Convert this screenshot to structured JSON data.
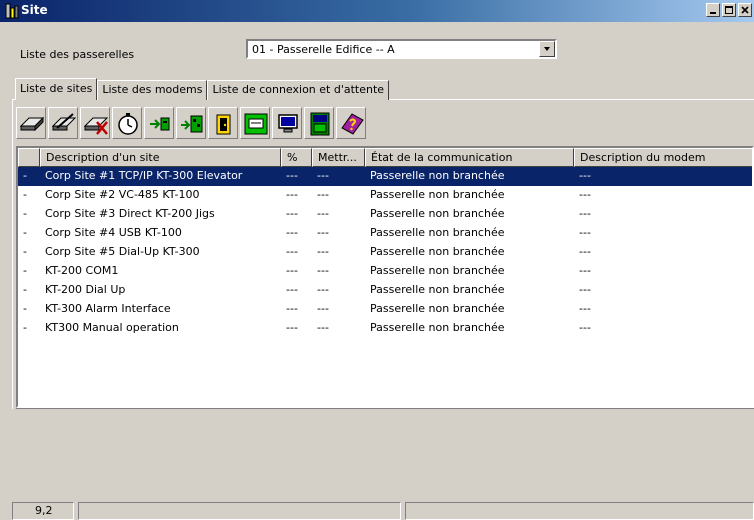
{
  "window": {
    "title": "Site",
    "icon": "site-app-icon"
  },
  "gateway": {
    "label": "Liste des passerelles",
    "selected": "01 - Passerelle Edifice -- A"
  },
  "tabs": [
    {
      "label": "Liste de sites",
      "active": true
    },
    {
      "label": "Liste des modems",
      "active": false
    },
    {
      "label": "Liste de connexion et d'attente",
      "active": false
    }
  ],
  "toolbar": [
    "add-site-icon",
    "edit-site-icon",
    "delete-site-icon",
    "schedule-clock-icon",
    "send-arrow-icon",
    "transfer-icon",
    "exit-door-icon",
    "network-icon",
    "monitor-icon",
    "serial-number-icon",
    "help-book-icon"
  ],
  "table": {
    "headers": [
      "",
      "Description d'un site",
      "%",
      "Mettr...",
      "État de la communication",
      "Description du modem"
    ],
    "rows": [
      [
        "-",
        "Corp Site #1 TCP/IP KT-300 Elevator",
        "---",
        "---",
        "Passerelle non branchée",
        "---"
      ],
      [
        "-",
        "Corp Site #2 VC-485 KT-100",
        "---",
        "---",
        "Passerelle non branchée",
        "---"
      ],
      [
        "-",
        "Corp Site #3  Direct KT-200 Jigs",
        "---",
        "---",
        "Passerelle non branchée",
        "---"
      ],
      [
        "-",
        "Corp Site #4 USB KT-100",
        "---",
        "---",
        "Passerelle non branchée",
        "---"
      ],
      [
        "-",
        "Corp Site #5 Dial-Up KT-300",
        "---",
        "---",
        "Passerelle non branchée",
        "---"
      ],
      [
        "-",
        "KT-200  COM1",
        "---",
        "---",
        "Passerelle non branchée",
        "---"
      ],
      [
        "-",
        "KT-200 Dial Up",
        "---",
        "---",
        "Passerelle non branchée",
        "---"
      ],
      [
        "-",
        "KT-300 Alarm Interface",
        "---",
        "---",
        "Passerelle non branchée",
        "---"
      ],
      [
        "-",
        "KT300 Manual operation",
        "---",
        "---",
        "Passerelle non branchée",
        "---"
      ]
    ],
    "selected_row": 0
  },
  "status": {
    "version": "9,2"
  },
  "colors": {
    "selection": "#0a246a",
    "titlebar": "#0a246a",
    "face": "#d4d0c8"
  }
}
